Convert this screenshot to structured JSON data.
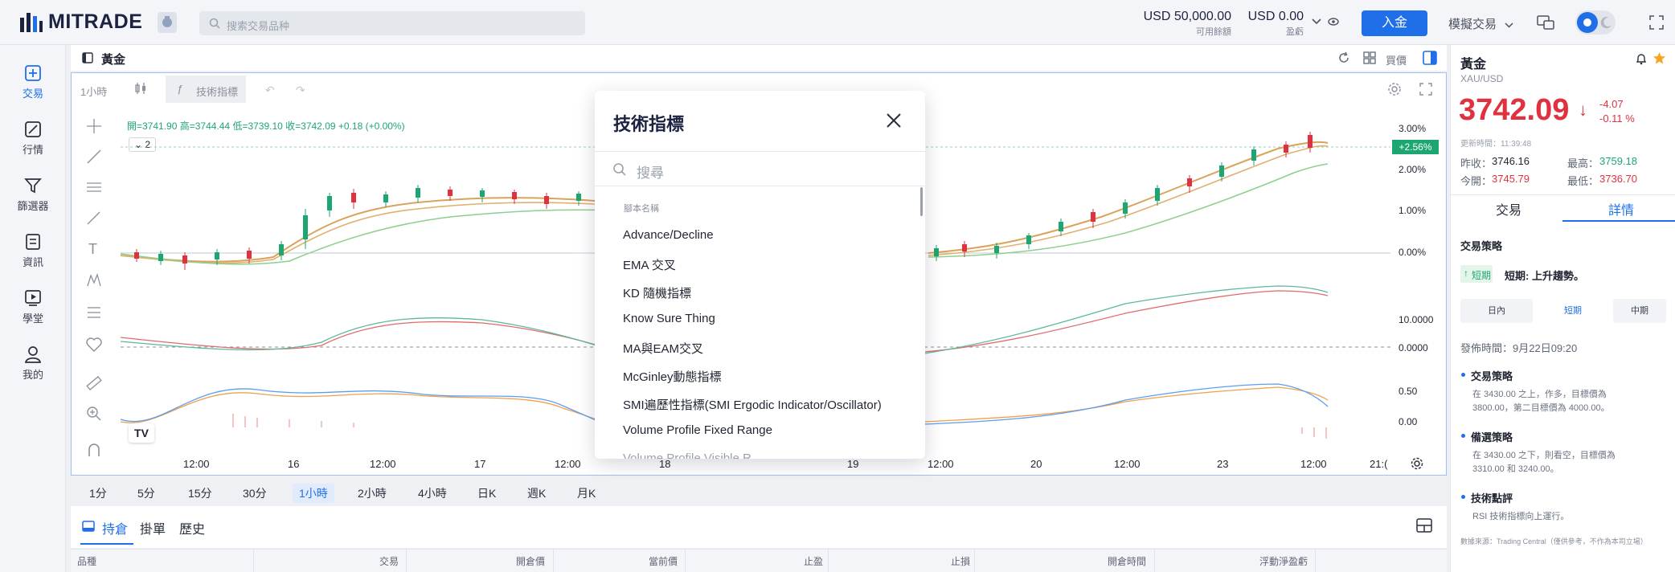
{
  "topbar": {
    "brand": "MITRADE",
    "search_placeholder": "搜索交易品种",
    "available_funds_value": "USD 50,000.00",
    "available_funds_label": "可用餘額",
    "pnl_value": "USD 0.00",
    "pnl_label": "盈虧",
    "deposit_label": "入金",
    "account_mode": "模擬交易",
    "colors": {
      "brand": "#1c2340",
      "accent": "#1f6fe8"
    }
  },
  "leftnav": {
    "items": [
      {
        "label": "交易",
        "icon": "trade-icon",
        "active": true
      },
      {
        "label": "行情",
        "icon": "market-icon",
        "active": false
      },
      {
        "label": "篩選器",
        "icon": "filter-icon",
        "active": false
      },
      {
        "label": "資訊",
        "icon": "news-icon",
        "active": false
      },
      {
        "label": "學堂",
        "icon": "academy-icon",
        "active": false
      },
      {
        "label": "我的",
        "icon": "profile-icon",
        "active": false
      }
    ]
  },
  "main": {
    "instrument_title": "黃金",
    "header_right_label": "買價",
    "toolbar": {
      "interval": "1小時",
      "indicators_label": "技術指標"
    },
    "ohlc": "開=3741.90  高=3744.44  低=3739.10  收=3742.09  +0.18 (+0.00%)",
    "legend_count": "2",
    "price_axis": [
      "3.00%",
      "2.00%",
      "1.00%",
      "0.00%"
    ],
    "current_change_badge": "+2.56%",
    "macd_axis": [
      "10.0000",
      "0.0000"
    ],
    "osc_axis": [
      "0.50",
      "0.00"
    ],
    "time_axis": [
      "12:00",
      "16",
      "12:00",
      "17",
      "12:00",
      "18",
      "19",
      "12:00",
      "20",
      "12:00",
      "23",
      "12:00",
      "21:("
    ],
    "timeframes": [
      "1分",
      "5分",
      "15分",
      "30分",
      "1小時",
      "2小時",
      "4小時",
      "日K",
      "週K",
      "月K"
    ],
    "active_timeframe": "1小時",
    "bottom_tabs": [
      "持倉",
      "掛單",
      "歷史"
    ],
    "table_headers": [
      "品種",
      "交易",
      "開倉價",
      "當前價",
      "止盈",
      "止損",
      "開倉時間",
      "浮動淨盈虧"
    ]
  },
  "modal": {
    "title": "技術指標",
    "search_placeholder": "搜尋",
    "section_label": "腳本名稱",
    "items": [
      "Advance/Decline",
      "EMA 交叉",
      "KD 隨機指標",
      "Know Sure Thing",
      "MA與EAM交叉",
      "McGinley動態指標",
      "SMI遍歷性指標(SMI Ergodic Indicator/Oscillator)",
      "Volume Profile Fixed Range"
    ],
    "partial_item": "Volume Profile Visible R..."
  },
  "right": {
    "name": "黃金",
    "symbol": "XAU/USD",
    "price": "3742.09",
    "change": "-4.07",
    "change_pct": "-0.11 %",
    "update_time": "更新時間：11:39:48",
    "prev_close_label": "昨收：",
    "prev_close": "3746.16",
    "high_label": "最高：",
    "high": "3759.18",
    "open_label": "今開：",
    "open": "3745.79",
    "low_label": "最低：",
    "low": "3736.70",
    "tabs": [
      "交易",
      "詳情"
    ],
    "active_tab": "詳情",
    "strategy_title": "交易策略",
    "term_badge": "短期",
    "term_text": "短期: 上升趨勢。",
    "periods": [
      "日內",
      "短期",
      "中期"
    ],
    "active_period": "短期",
    "publish_time": "發佈時間：9月22日09:20",
    "sections": [
      {
        "title": "交易策略",
        "text1": "在 3430.00 之上，作多，目標價為",
        "text2": "3800.00，第二目標價為 4000.00。"
      },
      {
        "title": "備選策略",
        "text1": "在 3430.00 之下，則看空，目標價為",
        "text2": "3310.00 和 3240.00。"
      },
      {
        "title": "技術點評",
        "text1": "RSI 技術指標向上運行。",
        "text2": ""
      }
    ],
    "source_note": "數據來源：Trading Central（僅供參考，不作為本司立場）",
    "colors": {
      "down": "#e0313f",
      "up": "#1ea672"
    }
  }
}
